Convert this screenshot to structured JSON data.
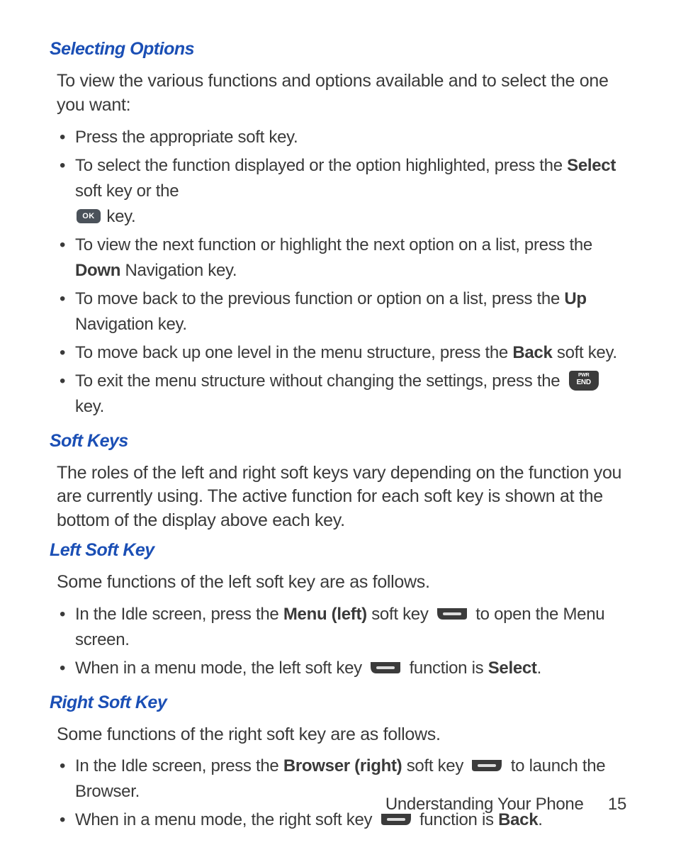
{
  "sections": {
    "selecting_options": {
      "heading": "Selecting Options",
      "intro": "To view the various functions and options available and to select the one you want:",
      "items": {
        "b1": "Press the appropriate soft key.",
        "b2a": "To select the function displayed or the option highlighted, press the ",
        "b2b_bold": "Select",
        "b2c": " soft key or the ",
        "b2d": " key.",
        "b3a": "To view the next function or highlight the next option on a list, press the ",
        "b3b_bold": "Down",
        "b3c": " Navigation key.",
        "b4a": "To move back to the previous function or option on a list, press the ",
        "b4b_bold": "Up",
        "b4c": " Navigation key.",
        "b5a": "To move back up one level in the menu structure, press the ",
        "b5b_bold": "Back",
        "b5c": " soft key.",
        "b6a": "To exit the menu structure without changing the settings, press the ",
        "b6b": " key."
      }
    },
    "soft_keys": {
      "heading": "Soft Keys",
      "para": "The roles of the left and right soft keys vary depending on the function you are currently using. The active function for each soft key is shown at the bottom of the display above each key."
    },
    "left_soft_key": {
      "heading": "Left Soft Key",
      "para": "Some functions of the left soft key are as follows.",
      "items": {
        "b1a": "In the Idle screen, press the ",
        "b1b_bold": "Menu (left)",
        "b1c": " soft key ",
        "b1d": " to open the Menu screen.",
        "b2a": "When in a menu mode, the left soft key ",
        "b2b": " function is ",
        "b2c_bold": "Select",
        "b2d": "."
      }
    },
    "right_soft_key": {
      "heading": "Right Soft Key",
      "para": "Some functions of the right soft key are as follows.",
      "items": {
        "b1a": "In the Idle screen, press the ",
        "b1b_bold": "Browser (right)",
        "b1c": " soft key ",
        "b1d": " to launch the Browser.",
        "b2a": "When in a menu mode, the right soft key ",
        "b2b": " function is ",
        "b2c_bold": "Back",
        "b2d": "."
      }
    }
  },
  "footer": {
    "section": "Understanding Your Phone",
    "page": "15"
  }
}
